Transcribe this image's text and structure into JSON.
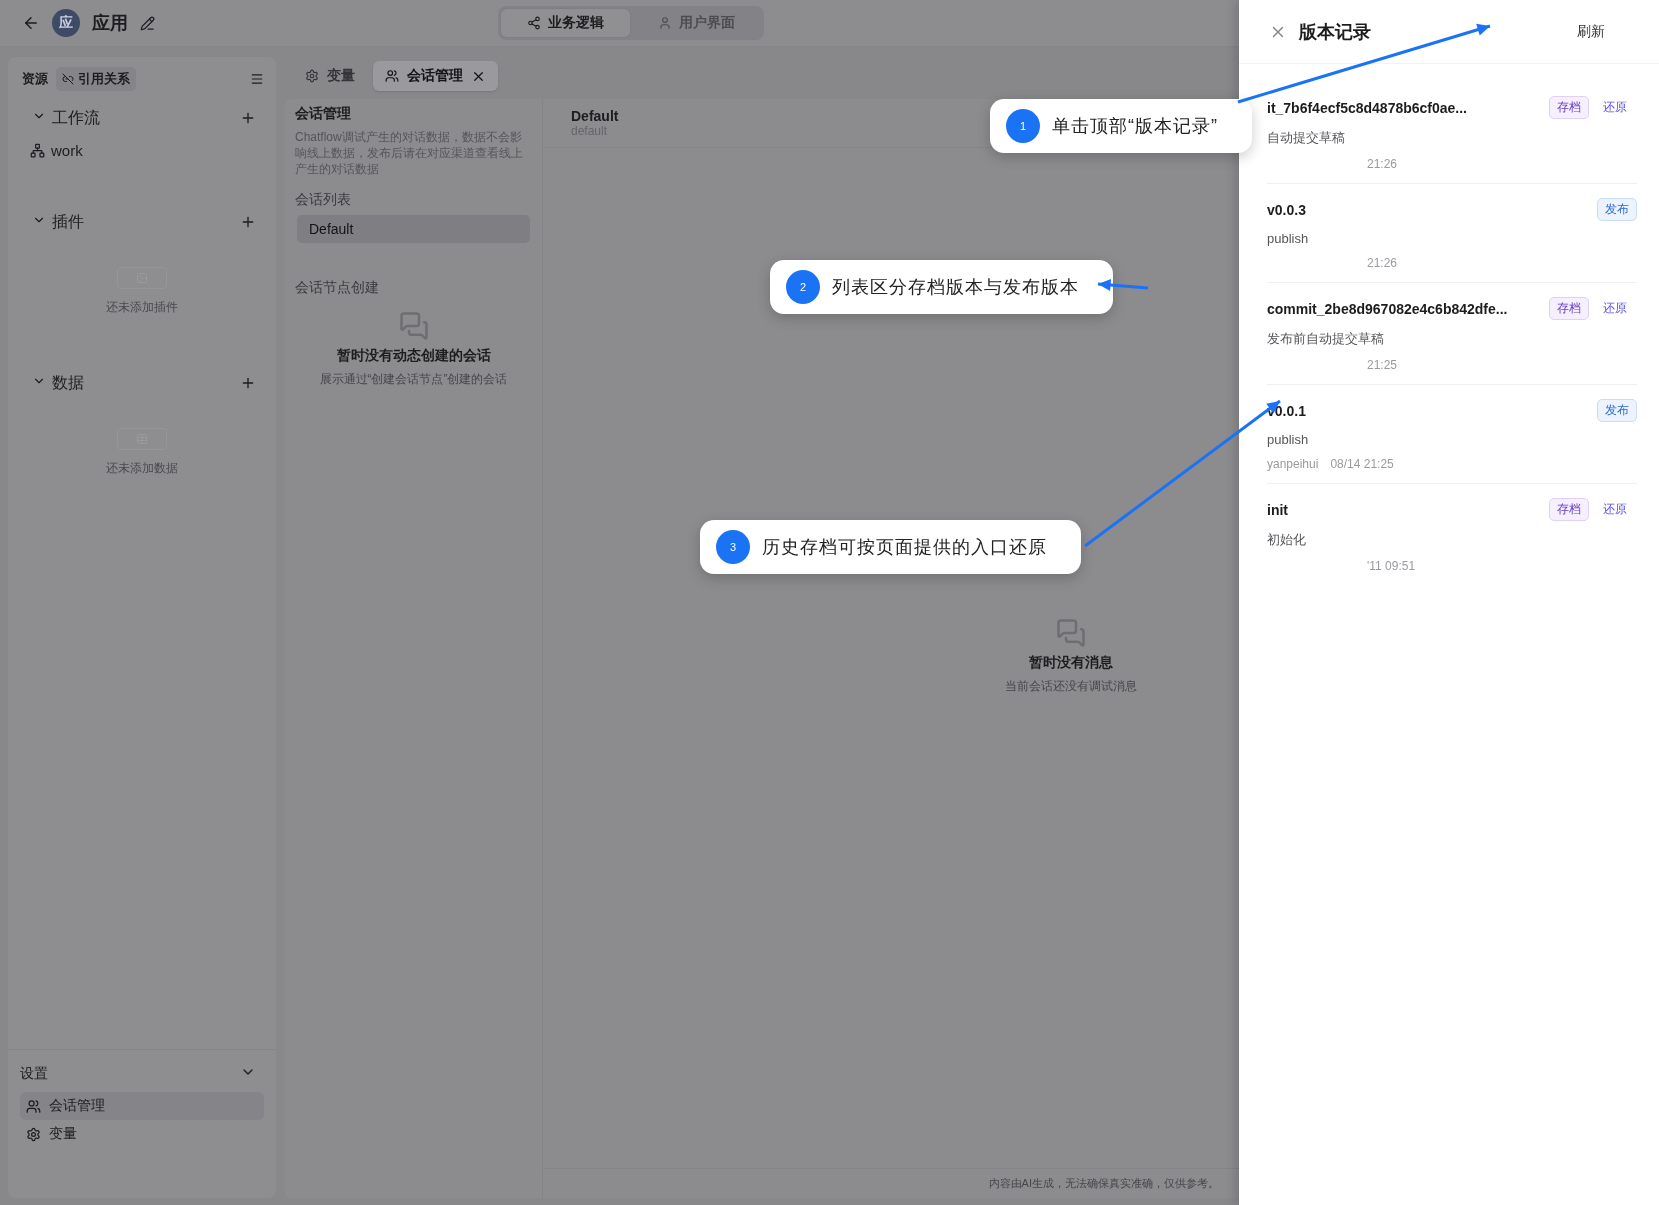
{
  "header": {
    "avatar": "应",
    "title": "应用"
  },
  "mode_switch": [
    {
      "label": "业务逻辑",
      "selected": true
    },
    {
      "label": "用户界面",
      "selected": false
    }
  ],
  "sidebar": {
    "tabs": [
      {
        "label": "资源",
        "selected": true
      },
      {
        "label": "引用关系",
        "selected": false
      }
    ],
    "sections": [
      {
        "title": "工作流",
        "expanded": true,
        "items": [
          {
            "label": "work"
          }
        ]
      },
      {
        "title": "插件",
        "expanded": true,
        "empty": "还未添加插件"
      },
      {
        "title": "数据",
        "expanded": true,
        "empty": "还未添加数据"
      }
    ],
    "settings": {
      "title": "设置",
      "expanded": true,
      "items": [
        {
          "label": "会话管理",
          "selected": true
        },
        {
          "label": "变量",
          "selected": false
        }
      ]
    }
  },
  "editor_tabs": [
    {
      "label": "变量",
      "selected": false,
      "closable": false
    },
    {
      "label": "会话管理",
      "selected": true,
      "closable": true
    }
  ],
  "conversation_panel": {
    "title": "会话管理",
    "description": "Chatflow调试产生的对话数据，数据不会影响线上数据，发布后请在对应渠道查看线上产生的对话数据",
    "list_title": "会话列表",
    "conversations": [
      {
        "name": "Default",
        "selected": true
      }
    ],
    "node_title": "会话节点创建",
    "empty_title": "暂时没有动态创建的会话",
    "empty_text": "展示通过“创建会话节点”创建的会话"
  },
  "chat": {
    "title": "Default",
    "subtitle": "default",
    "empty_title": "暂时没有消息",
    "empty_text": "当前会话还没有调试消息",
    "disclaimer": "内容由AI生成，无法确保真实准确，仅供参考。"
  },
  "drawer": {
    "title": "版本记录",
    "refresh": "刷新",
    "versions": [
      {
        "title": "it_7b6f4ecf5c8d4878b6cf0ae...",
        "kind": "archive",
        "tag": "存档",
        "restore": "还原",
        "description": "自动提交草稿",
        "time": "21:26"
      },
      {
        "title": "v0.0.3",
        "kind": "publish",
        "tag": "发布",
        "description": "publish",
        "time": "21:26"
      },
      {
        "title": "commit_2be8d967082e4c6b842dfe...",
        "kind": "archive",
        "tag": "存档",
        "restore": "还原",
        "description": "发布前自动提交草稿",
        "time": "21:25"
      },
      {
        "title": "v0.0.1",
        "kind": "publish",
        "tag": "发布",
        "description": "publish",
        "author": "yanpeihui",
        "time": "08/14 21:25"
      },
      {
        "title": "init",
        "kind": "archive",
        "tag": "存档",
        "restore": "还原",
        "description": "初始化",
        "time": "'11 09:51"
      }
    ]
  },
  "callouts": [
    {
      "number": "1",
      "text": "单击顶部“版本记录”"
    },
    {
      "number": "2",
      "text": "列表区分存档版本与发布版本"
    },
    {
      "number": "3",
      "text": "历史存档可按页面提供的入口还原"
    }
  ]
}
